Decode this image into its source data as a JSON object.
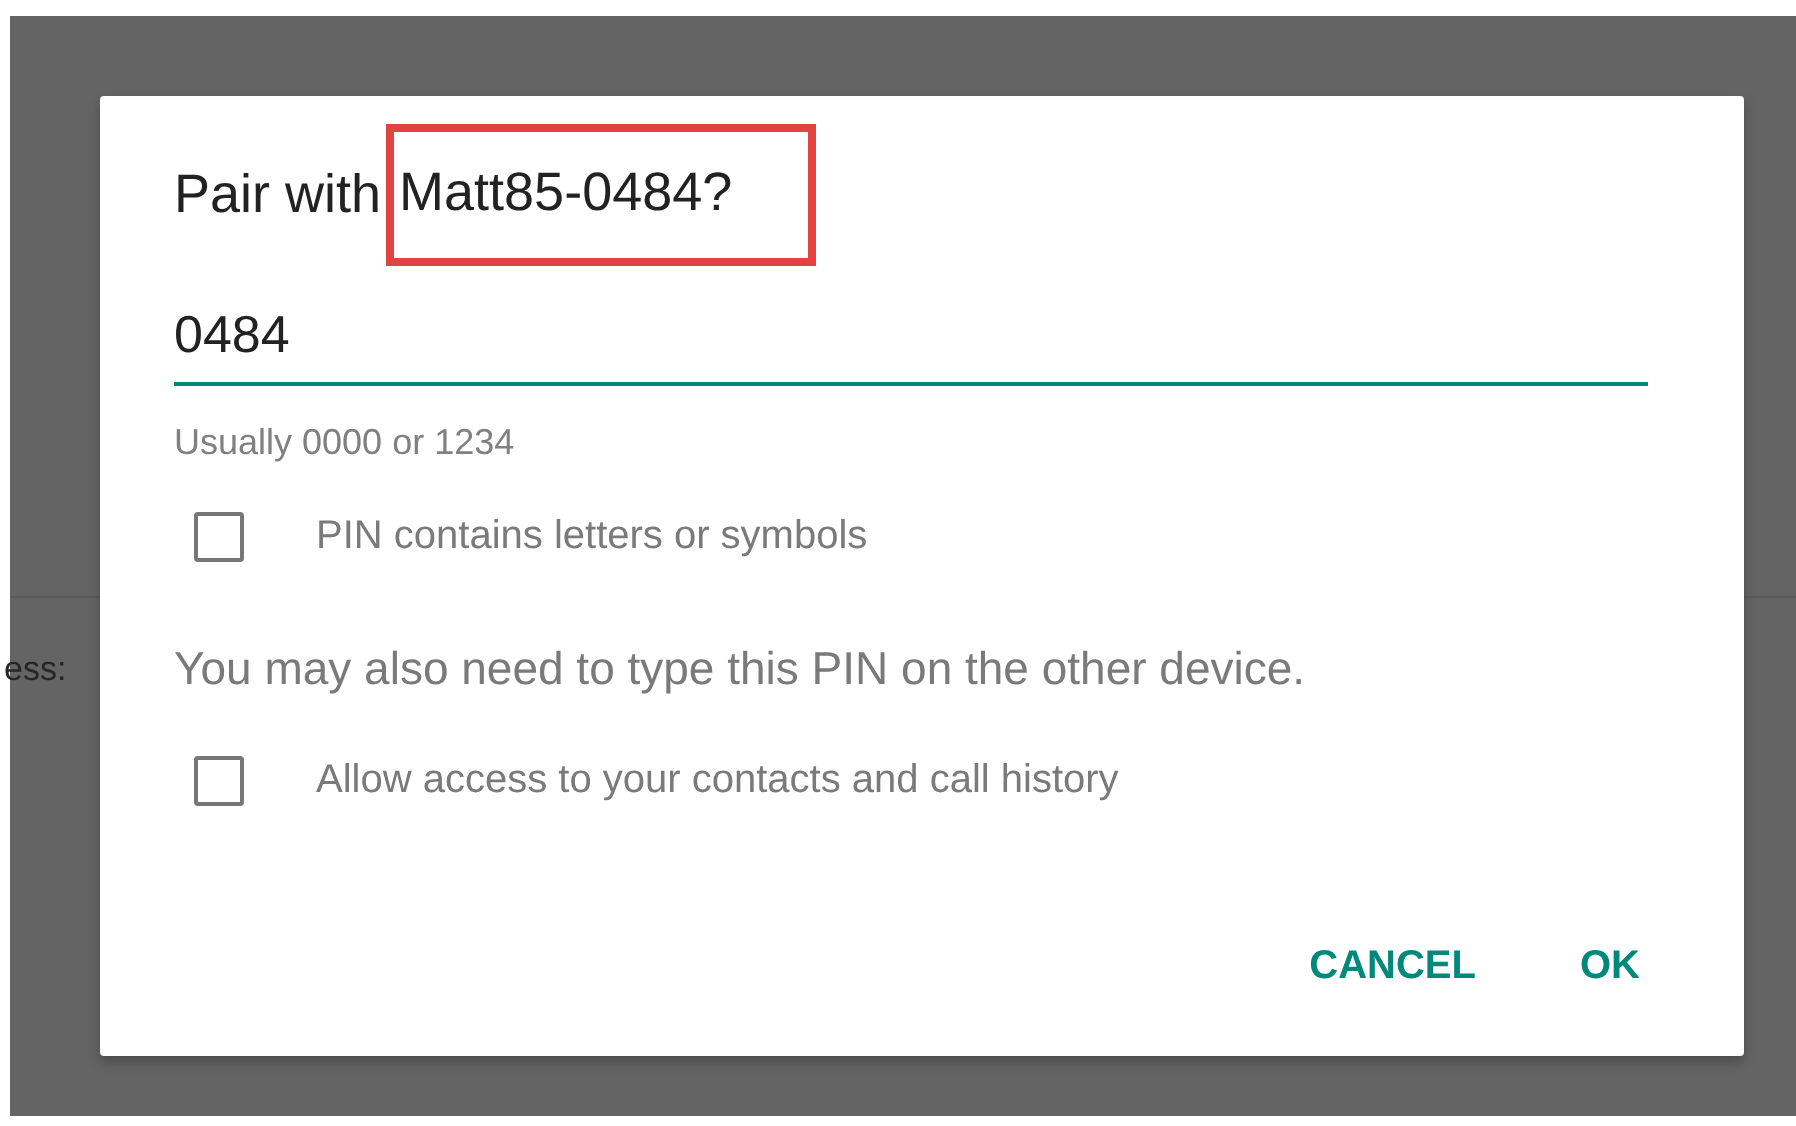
{
  "background": {
    "text": "ess:"
  },
  "dialog": {
    "title": {
      "prefix": "Pair with",
      "device": "Matt85-0484?",
      "highlighted": true
    },
    "pin_field": {
      "value": "0484",
      "focused": true
    },
    "helper": "Usually 0000 or 1234",
    "options": [
      {
        "label": "PIN contains letters or symbols",
        "checked": false
      }
    ],
    "message": "You may also need to type this PIN on the other device.",
    "sharing": [
      {
        "label": "Allow access to your contacts and call history",
        "checked": false
      }
    ],
    "buttons": [
      "CANCEL",
      "OK"
    ]
  }
}
